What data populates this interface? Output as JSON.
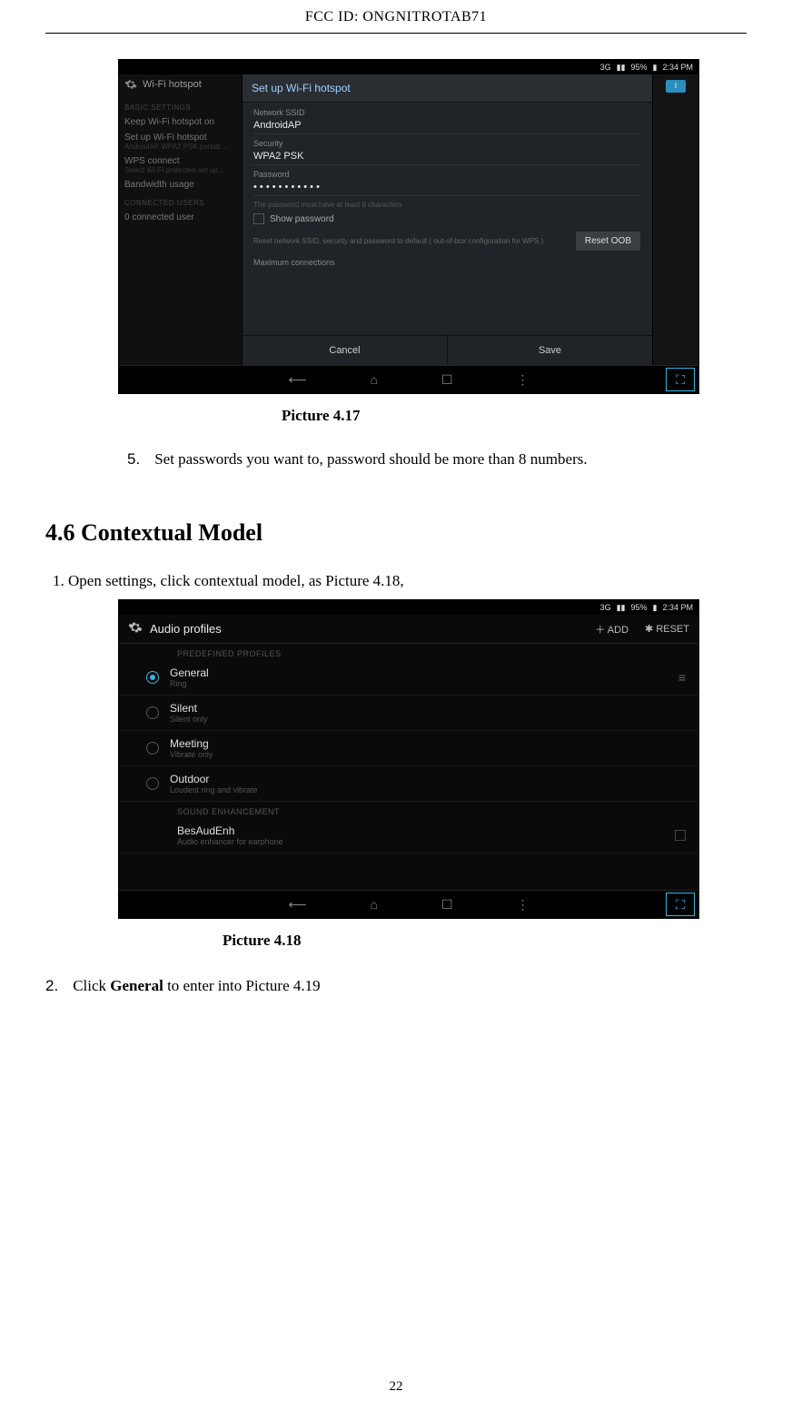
{
  "header": {
    "fcc_label": "FCC ID:",
    "fcc_id": "ONGNITROTAB71"
  },
  "page_number": "22",
  "shot1": {
    "status": {
      "signal": "3G",
      "signal_icon": "▮▮",
      "battery_pct": "95%",
      "time": "2:34 PM"
    },
    "left": {
      "title": "Wi-Fi hotspot",
      "sec_basic": "BASIC SETTINGS",
      "items": [
        {
          "t": "Keep Wi-Fi hotspot on",
          "s": ""
        },
        {
          "t": "Set up Wi-Fi hotspot",
          "s": "AndroidAP WPA2 PSK portab…"
        },
        {
          "t": "WPS connect",
          "s": "Select Wi-Fi protected set up…"
        },
        {
          "t": "Bandwidth usage",
          "s": ""
        }
      ],
      "sec_conn": "CONNECTED USERS",
      "conn_item": "0 connected user"
    },
    "dialog": {
      "title": "Set up Wi-Fi hotspot",
      "ssid_label": "Network SSID",
      "ssid_value": "AndroidAP",
      "sec_label": "Security",
      "sec_value": "WPA2 PSK",
      "pwd_label": "Password",
      "pwd_value": "• • • • • • • • • • •",
      "pwd_hint": "The password must have at least 8 characters",
      "show_pwd": "Show password",
      "reset_text": "Reset network SSID, security and password to default ( out-of-box configuration for WPS )",
      "reset_btn": "Reset OOB",
      "max_conn": "Maximum connections",
      "cancel": "Cancel",
      "save": "Save"
    },
    "toggle": "I"
  },
  "caption1": "Picture 4.17",
  "step5": {
    "num": "5.",
    "text": "Set passwords you want to, password should be more than 8 numbers."
  },
  "heading": "4.6 Contextual Model",
  "para1": "1. Open settings, click contextual model, as Picture 4.18,",
  "shot2": {
    "status": {
      "signal": "3G",
      "signal_icon": "▮▮",
      "battery_pct": "95%",
      "time": "2:34 PM"
    },
    "title": "Audio profiles",
    "add": "ADD",
    "reset": "RESET",
    "sec1": "PREDEFINED PROFILES",
    "rows": [
      {
        "t": "General",
        "s": "Ring",
        "sel": true,
        "slider": true
      },
      {
        "t": "Silent",
        "s": "Silent only",
        "sel": false,
        "slider": false
      },
      {
        "t": "Meeting",
        "s": "Vibrate only",
        "sel": false,
        "slider": false
      },
      {
        "t": "Outdoor",
        "s": "Loudest ring and vibrate",
        "sel": false,
        "slider": false
      }
    ],
    "sec2": "SOUND ENHANCEMENT",
    "bes": {
      "t": "BesAudEnh",
      "s": "Audio enhancer for earphone"
    }
  },
  "caption2": "Picture 4.18",
  "step2": {
    "num": "2.",
    "pre": "Click ",
    "bold": "General",
    "post": " to enter into Picture 4.19"
  }
}
